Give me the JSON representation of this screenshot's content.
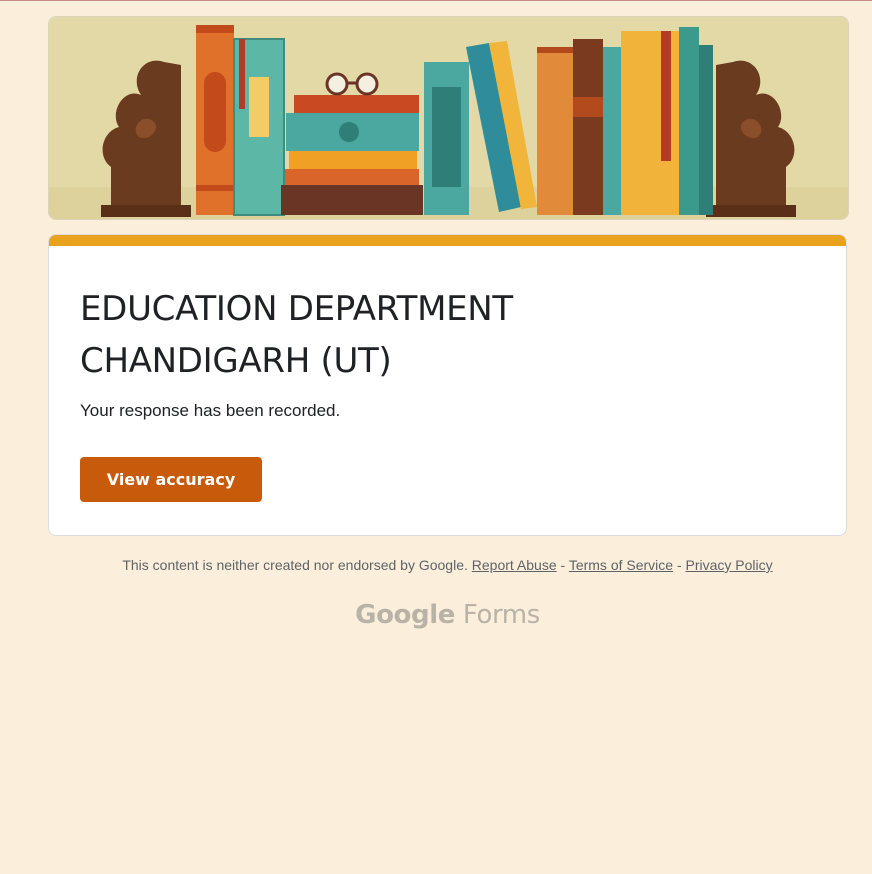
{
  "header": {
    "image": "bookshelf-banner"
  },
  "card": {
    "title": "EDUCATION DEPARTMENT CHANDIGARH (UT)",
    "message": "Your response has been recorded.",
    "button_label": "View accuracy",
    "accent_color": "#e8a21e",
    "button_color": "#c75b0b"
  },
  "footer": {
    "disclaimer": "This content is neither created nor endorsed by Google.",
    "separator": "-",
    "report_abuse": "Report Abuse",
    "terms": "Terms of Service",
    "privacy": "Privacy Policy"
  },
  "brand": {
    "google": "Google",
    "forms": "Forms"
  },
  "colors": {
    "background": "#fbefdc"
  }
}
